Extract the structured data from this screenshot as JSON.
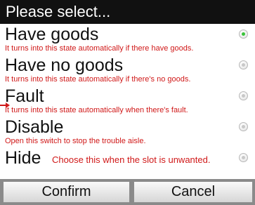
{
  "title": "Please select...",
  "options": [
    {
      "label": "Have goods",
      "description": "It turns into this state automatically if there have goods.",
      "selected": true
    },
    {
      "label": "Have no goods",
      "description": "It turns into this state automatically if there's no goods.",
      "selected": false
    },
    {
      "label": "Fault",
      "description": "It turns into this state automatically when there's fault.",
      "selected": false
    },
    {
      "label": "Disable",
      "description": "Open this switch to stop the trouble aisle.",
      "selected": false
    },
    {
      "label": "Hide",
      "description": "Choose this when the slot is unwanted.",
      "selected": false
    }
  ],
  "buttons": {
    "confirm": "Confirm",
    "cancel": "Cancel"
  },
  "colors": {
    "title_bar": "#111111",
    "description_text": "#d01818",
    "selected_radio": "#3bc33b",
    "footer": "#8a8a8a"
  }
}
